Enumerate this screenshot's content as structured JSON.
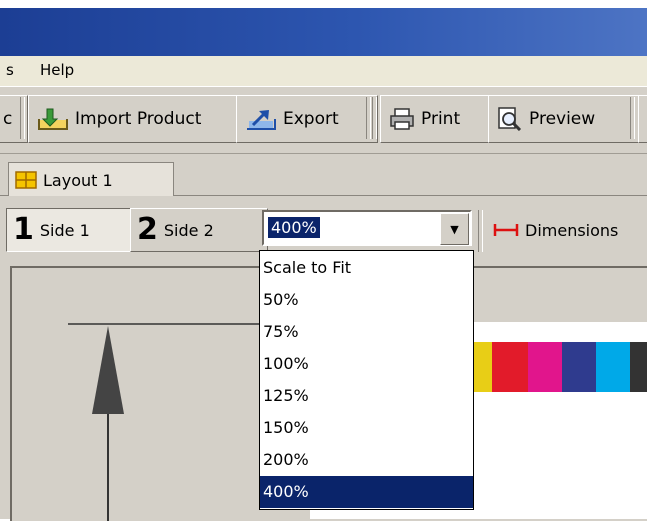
{
  "menu": {
    "partial_item": "s",
    "help": "Help"
  },
  "toolbar": {
    "partial_label": "c",
    "import_product": "Import Product",
    "export": "Export",
    "print": "Print",
    "preview": "Preview"
  },
  "tabs": [
    {
      "label": "Layout 1"
    }
  ],
  "sides": [
    {
      "number": "1",
      "label": "Side 1"
    },
    {
      "number": "2",
      "label": "Side 2"
    }
  ],
  "zoom": {
    "value": "400%",
    "options": [
      "Scale to Fit",
      "50%",
      "75%",
      "100%",
      "125%",
      "150%",
      "200%",
      "400%"
    ],
    "selected_index": 7
  },
  "dimensions_label": "Dimensions",
  "colors": {
    "selection": "#0a246a",
    "swatches": [
      "#e8ce16",
      "#e21b2a",
      "#e1158c",
      "#2f3b8e",
      "#00a9e8",
      "#333333"
    ]
  }
}
